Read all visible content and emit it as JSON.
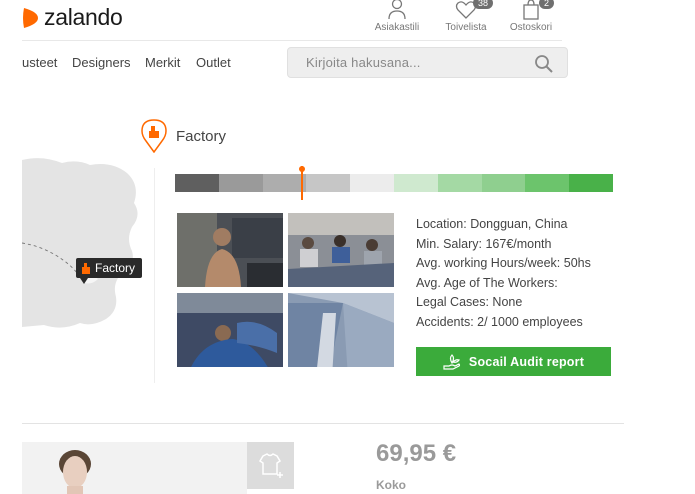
{
  "header": {
    "logo_text": "zalando",
    "brand_color": "#ff6900",
    "icons": [
      {
        "name": "account",
        "label": "Asiakastili",
        "badge": null
      },
      {
        "name": "wishlist",
        "label": "Toivelista",
        "badge": "38"
      },
      {
        "name": "cart",
        "label": "Ostoskori",
        "badge": "2"
      }
    ]
  },
  "nav": {
    "items": [
      "usteet",
      "Designers",
      "Merkit",
      "Outlet"
    ],
    "search_placeholder": "Kirjoita hakusana..."
  },
  "factory": {
    "title": "Factory",
    "map_label": "Factory",
    "scale_colors": [
      "#5f5f5f",
      "#9a9a9a",
      "#adadad",
      "#c6c6c6",
      "#ececec",
      "#cfe9cf",
      "#a4d9a4",
      "#8fcf8f",
      "#6cc46c",
      "#49b149"
    ],
    "scale_marker_position": 0.29,
    "accent_color": "#ff6900",
    "info": [
      "Location: Dongguan, China",
      "Min. Salary: 167€/month",
      "Avg. working Hours/week: 50hs",
      "Avg. Age of The Workers:",
      "Legal Cases: None",
      "Accidents: 2/ 1000 employees"
    ],
    "audit_button": "Socail Audit report",
    "audit_color": "#3bab3b"
  },
  "product": {
    "price": "69,95 €",
    "size_label": "Koko"
  }
}
